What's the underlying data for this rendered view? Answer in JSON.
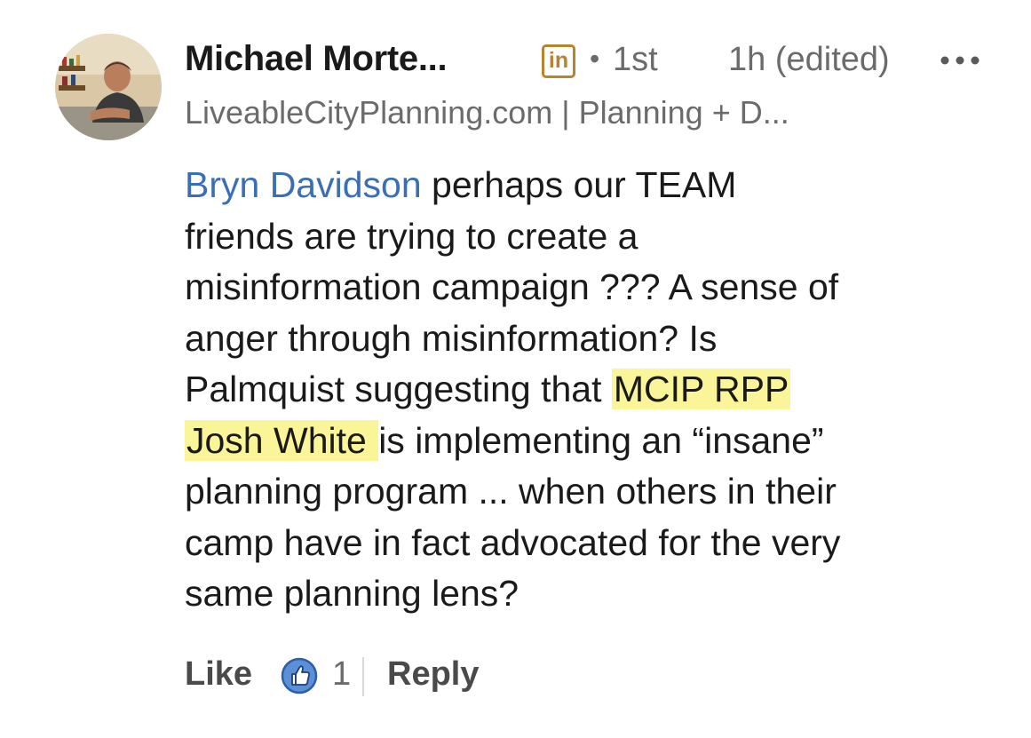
{
  "comment": {
    "author_name": "Michael Morte...",
    "network_badge": "in",
    "separator": "•",
    "connection_degree": "1st",
    "timestamp": "1h (edited)",
    "more_icon": "more-horizontal-icon",
    "headline": "LiveableCityPlanning.com | Planning + D...",
    "mention": "Bryn Davidson",
    "highlight_color": "#fbf59a",
    "mention_color": "#3a6fb5",
    "lines": {
      "l1_rest": " perhaps our TEAM",
      "l2": "friends are trying to create a",
      "l3": "misinformation campaign ??? A sense of",
      "l4": "anger through misinformation? Is",
      "l5_pre": "Palmquist suggesting that ",
      "l5_hl": "MCIP RPP",
      "l6_hl": "Josh White ",
      "l6_post": "is implementing an “insane”",
      "l7": "planning program ... when others in their",
      "l8": "camp have in fact advocated for the very",
      "l9": "same planning lens?"
    }
  },
  "actions": {
    "like_label": "Like",
    "like_icon": "thumbs-up-icon",
    "like_count": "1",
    "reply_label": "Reply"
  }
}
